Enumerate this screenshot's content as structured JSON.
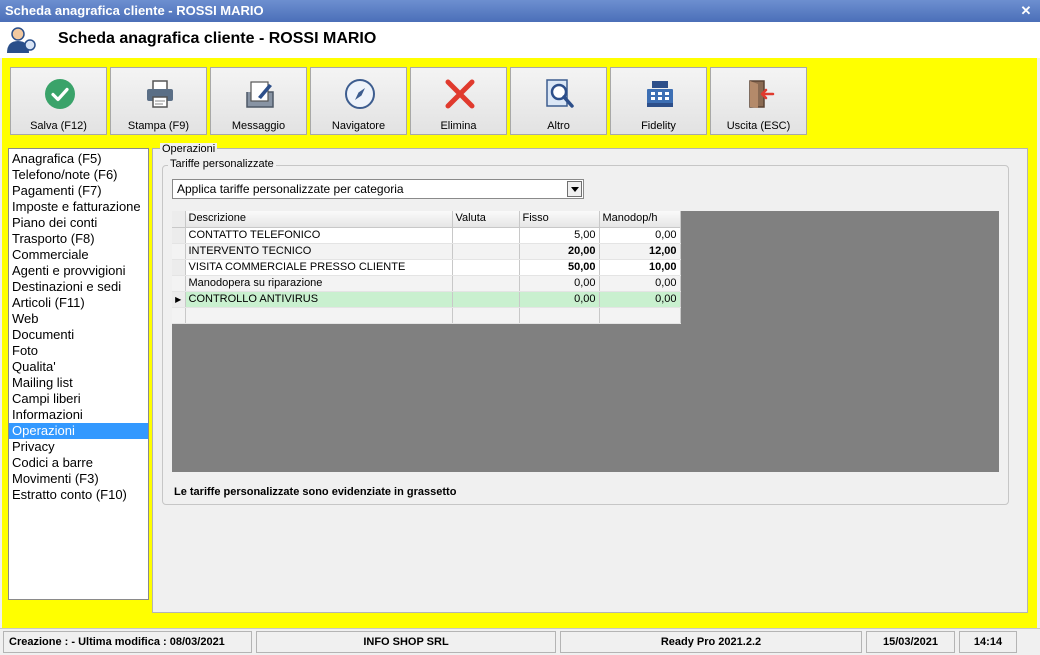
{
  "window": {
    "title": "Scheda anagrafica cliente - ROSSI MARIO",
    "close_glyph": "✕"
  },
  "header": {
    "title": "Scheda anagrafica cliente - ROSSI MARIO",
    "icon": "customer-icon"
  },
  "colors": {
    "background_accent": "#ffff00",
    "selection": "#3399ff",
    "current_row": "#c9f0cf",
    "grid_empty": "#808080"
  },
  "toolbar": {
    "buttons": [
      {
        "label": "Salva (F12)",
        "icon": "check-icon"
      },
      {
        "label": "Stampa (F9)",
        "icon": "printer-icon"
      },
      {
        "label": "Messaggio",
        "icon": "message-icon"
      },
      {
        "label": "Navigatore",
        "icon": "compass-icon"
      },
      {
        "label": "Elimina",
        "icon": "delete-icon"
      },
      {
        "label": "Altro",
        "icon": "magnifier-icon"
      },
      {
        "label": "Fidelity",
        "icon": "cash-register-icon"
      },
      {
        "label": "Uscita (ESC)",
        "icon": "exit-icon"
      }
    ]
  },
  "nav": {
    "items": [
      "Anagrafica (F5)",
      "Telefono/note (F6)",
      "Pagamenti (F7)",
      "Imposte e fatturazione",
      "Piano dei conti",
      "Trasporto (F8)",
      "Commerciale",
      "Agenti e provvigioni",
      "Destinazioni e sedi",
      "Articoli (F11)",
      "Web",
      "Documenti",
      "Foto",
      "Qualita'",
      "Mailing list",
      "Campi liberi",
      "Informazioni",
      "Operazioni",
      "Privacy",
      "Codici a barre",
      "Movimenti (F3)",
      "Estratto conto (F10)"
    ],
    "selected": "Operazioni"
  },
  "panel": {
    "group_title": "Operazioni",
    "subgroup_title": "Tariffe personalizzate",
    "select_value": "Applica tariffe personalizzate per categoria",
    "note": "Le tariffe personalizzate sono evidenziate in grassetto"
  },
  "grid": {
    "columns": [
      "Descrizione",
      "Valuta",
      "Fisso",
      "Manodop/h"
    ],
    "rows": [
      {
        "descrizione": "CONTATTO TELEFONICO",
        "valuta": "",
        "fisso": "5,00",
        "manodop": "0,00"
      },
      {
        "descrizione": "INTERVENTO TECNICO",
        "valuta": "",
        "fisso": "20,00",
        "manodop": "12,00"
      },
      {
        "descrizione": "VISITA COMMERCIALE PRESSO CLIENTE",
        "valuta": "",
        "fisso": "50,00",
        "manodop": "10,00"
      },
      {
        "descrizione": "Manodopera su riparazione",
        "valuta": "",
        "fisso": "0,00",
        "manodop": "0,00"
      },
      {
        "descrizione": "CONTROLLO ANTIVIRUS",
        "valuta": "",
        "fisso": "0,00",
        "manodop": "0,00"
      },
      {
        "descrizione": "",
        "valuta": "",
        "fisso": "",
        "manodop": ""
      }
    ],
    "current_row_indicator": "▶"
  },
  "status": {
    "created": "Creazione :  - Ultima modifica : 08/03/2021",
    "company": "INFO SHOP SRL",
    "version": "Ready Pro 2021.2.2",
    "date": "15/03/2021",
    "time": "14:14"
  }
}
